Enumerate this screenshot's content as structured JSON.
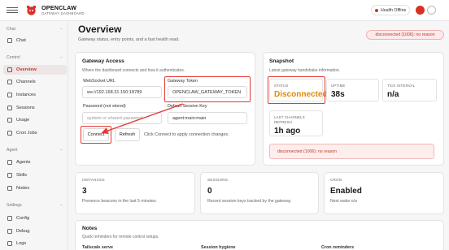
{
  "app": {
    "name": "OPENCLAW",
    "subtitle": "GATEWAY DASHBOARD",
    "health_label": "Health Offline"
  },
  "sidebar": {
    "sections": [
      {
        "label": "Chat",
        "toggle": "–",
        "items": [
          {
            "label": "Chat",
            "icon": "chat-icon"
          }
        ]
      },
      {
        "label": "Control",
        "toggle": "–",
        "items": [
          {
            "label": "Overview",
            "icon": "overview-icon",
            "active": true
          },
          {
            "label": "Channels",
            "icon": "channels-icon"
          },
          {
            "label": "Instances",
            "icon": "instances-icon"
          },
          {
            "label": "Sessions",
            "icon": "sessions-icon"
          },
          {
            "label": "Usage",
            "icon": "usage-icon"
          },
          {
            "label": "Cron Jobs",
            "icon": "cron-icon"
          }
        ]
      },
      {
        "label": "Agent",
        "toggle": "–",
        "items": [
          {
            "label": "Agents",
            "icon": "agents-icon"
          },
          {
            "label": "Skills",
            "icon": "skills-icon"
          },
          {
            "label": "Nodes",
            "icon": "nodes-icon"
          }
        ]
      },
      {
        "label": "Settings",
        "toggle": "–",
        "items": [
          {
            "label": "Config",
            "icon": "config-icon"
          },
          {
            "label": "Debug",
            "icon": "debug-icon"
          },
          {
            "label": "Logs",
            "icon": "logs-icon"
          }
        ]
      }
    ]
  },
  "page": {
    "title": "Overview",
    "subtitle": "Gateway status, entry points, and a fast health read.",
    "status_pill": "disconnected (1006): no reason"
  },
  "gateway": {
    "title": "Gateway Access",
    "subtitle": "Where the dashboard connects and how it authenticates.",
    "ws_label": "WebSocket URL",
    "ws_value": "ws://192.168.31.150:18789",
    "token_label": "Gateway Token",
    "token_value": "OPENCLAW_GATEWAY_TOKEN",
    "password_label": "Password (not stored)",
    "password_placeholder": "system or shared password",
    "session_label": "Default Session Key",
    "session_value": "agent:main:main",
    "connect": "Connect",
    "refresh": "Refresh",
    "hint": "Click Connect to apply connection changes."
  },
  "snapshot": {
    "title": "Snapshot",
    "subtitle": "Latest gateway handshake information.",
    "stats": [
      {
        "key": "STATUS",
        "value": "Disconnected"
      },
      {
        "key": "UPTIME",
        "value": "38s"
      },
      {
        "key": "TICK INTERVAL",
        "value": "n/a"
      },
      {
        "key": "LAST CHANNELS REFRESH",
        "value": "1h ago"
      }
    ],
    "error": "disconnected (1006): no reason"
  },
  "summary": [
    {
      "key": "INSTANCES",
      "value": "3",
      "desc": "Presence beacons in the last 5 minutes."
    },
    {
      "key": "SESSIONS",
      "value": "0",
      "desc": "Recent session keys tracked by the gateway."
    },
    {
      "key": "CRON",
      "value": "Enabled",
      "desc": "Next wake n/a"
    }
  ],
  "notes": {
    "title": "Notes",
    "subtitle": "Quick reminders for remote control setups.",
    "columns": [
      "Tailscale serve",
      "Session hygiene",
      "Cron reminders"
    ]
  },
  "colors": {
    "accent": "#c0392b",
    "error": "#d93025",
    "warning_text": "#e08a00",
    "highlight": "#e53935"
  }
}
